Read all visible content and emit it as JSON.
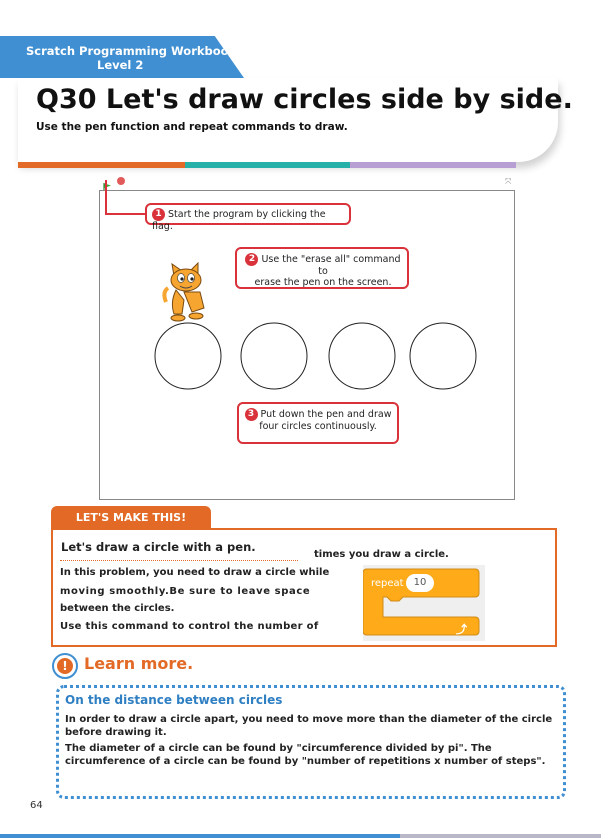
{
  "header": {
    "book_title_line1": "Scratch Programming Workbook",
    "book_title_line2": "Level 2",
    "question_title": "Q30 Let's draw circles side by side.",
    "question_subtitle": "Use the pen function and repeat commands to draw."
  },
  "colors": {
    "blue": "#3f8fd2",
    "orange": "#e36a26",
    "teal": "#26b0a8",
    "lavender": "#b79fd3",
    "callout_red": "#d9323a",
    "block_orange": "#ffab19"
  },
  "stage": {
    "callouts": [
      {
        "number": "1",
        "text": "Start the program by clicking the flag."
      },
      {
        "number": "2",
        "text_line1": "Use the \"erase all\" command to",
        "text_line2": "erase the pen on the screen."
      },
      {
        "number": "3",
        "text_line1": "Put down the pen and draw",
        "text_line2": "four circles continuously."
      }
    ],
    "icons": {
      "flag": "green-flag-icon",
      "stop": "stop-icon",
      "fullscreen": "fullscreen-icon",
      "sprite": "scratch-cat-sprite"
    }
  },
  "make_this": {
    "tab_label": "LET'S MAKE THIS!",
    "heading": "Let's draw a circle with a pen.",
    "para1_line1": "In this problem, you need to draw a circle while",
    "para1_line2": "moving smoothly.Be sure to leave space",
    "para1_line3": "between the circles.",
    "para2_line1": "Use this command to control the number of",
    "para2_line2": "times you draw a circle.",
    "block_label": "repeat",
    "block_value": "10"
  },
  "learn_more": {
    "title": "Learn more.",
    "heading": "On the distance between circles",
    "p1": "In order to draw a circle apart, you need to move more than the diameter of the circle before drawing it.",
    "p2": "The diameter of a circle can be found by \"circumference divided by pi\". The circumference of a circle can be found by \"number of repetitions x number of steps\"."
  },
  "page_number": "64"
}
